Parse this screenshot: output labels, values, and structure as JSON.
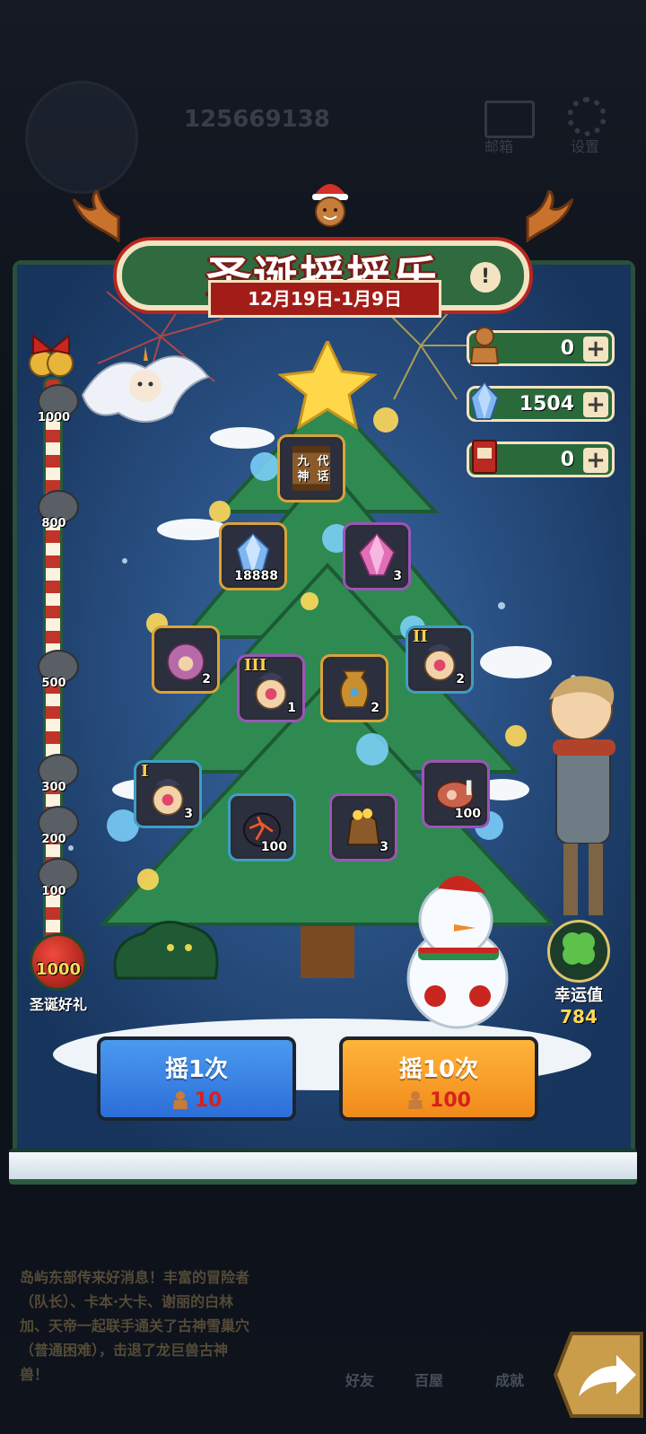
{
  "background": {
    "user_id": "125669138",
    "mail_label": "邮箱",
    "settings_label": "设置",
    "story_text": "岛屿东部传来好消息！丰富的冒险者（队长）、卡本·大卡、谢丽的白林加、天帝一起联手通关了古神雪巢穴（普通困难），击退了龙巨兽古神兽！",
    "nav": [
      "好友",
      "百屋",
      "成就"
    ]
  },
  "event": {
    "title": "圣诞摇摇乐",
    "date_range": "12月19日-1月9日",
    "info_label": "!"
  },
  "currencies": [
    {
      "icon": "gingerbread-icon",
      "value": "0",
      "plus": "+"
    },
    {
      "icon": "crystal-icon",
      "value": "1504",
      "plus": "+"
    },
    {
      "icon": "ticket-icon",
      "value": "0",
      "plus": "+"
    }
  ],
  "progress": {
    "milestones": [
      "1000",
      "800",
      "500",
      "300",
      "200",
      "100"
    ],
    "gift_value": "1000",
    "gift_label": "圣诞好礼"
  },
  "tree_items": [
    {
      "name": "myth-scroll",
      "count": "",
      "rank": "",
      "caption": [
        "九",
        "代",
        "神",
        "话"
      ]
    },
    {
      "name": "blue-crystal",
      "count": "18888",
      "rank": ""
    },
    {
      "name": "pink-crystal",
      "count": "3",
      "rank": ""
    },
    {
      "name": "paw-cookie",
      "count": "2",
      "rank": ""
    },
    {
      "name": "pet-box-3",
      "count": "1",
      "rank": "III"
    },
    {
      "name": "golden-vase",
      "count": "2",
      "rank": ""
    },
    {
      "name": "pet-box-2",
      "count": "2",
      "rank": "II"
    },
    {
      "name": "pet-box-1",
      "count": "3",
      "rank": "I"
    },
    {
      "name": "lava-stone",
      "count": "100",
      "rank": ""
    },
    {
      "name": "gold-bag",
      "count": "3",
      "rank": ""
    },
    {
      "name": "meat",
      "count": "100",
      "rank": ""
    }
  ],
  "luck": {
    "label": "幸运值",
    "value": "784"
  },
  "actions": {
    "shake_once": {
      "label": "摇1次",
      "cost": "10"
    },
    "shake_ten": {
      "label": "摇10次",
      "cost": "100"
    }
  },
  "colors": {
    "panel": "#234a7a",
    "banner_green": "#2f6b3e",
    "ribbon_red": "#a31d18",
    "blue_button": "#2c6ed8",
    "orange_button": "#f18a1a",
    "cost_red": "#d8201c"
  }
}
